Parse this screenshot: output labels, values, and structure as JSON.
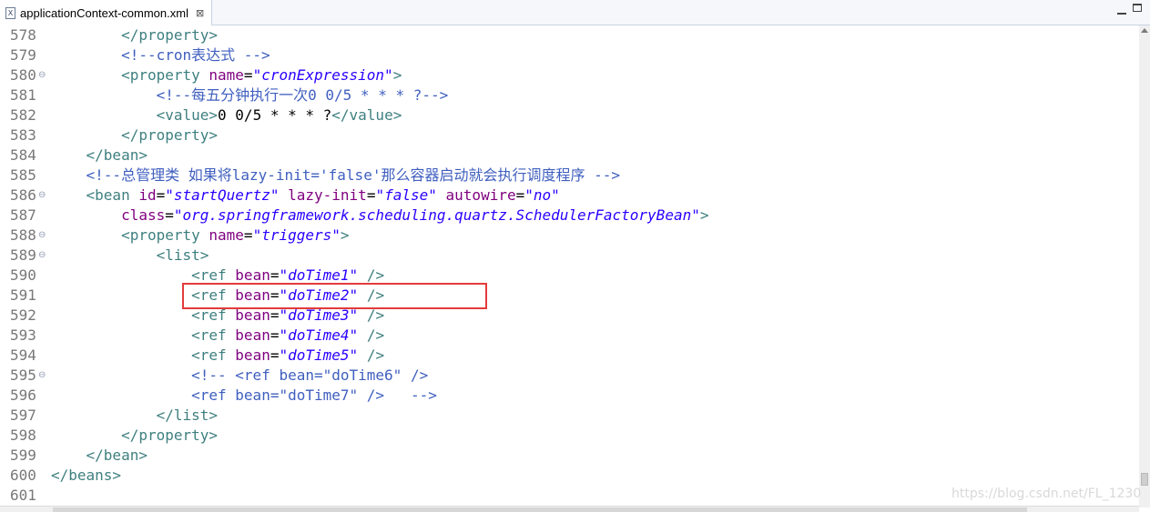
{
  "tab": {
    "icon": "xml-file-icon",
    "icon_glyph": "X",
    "title": "applicationContext-common.xml",
    "close_glyph": "⊠"
  },
  "lines": [
    {
      "num": "578",
      "fold": "",
      "segs": [
        {
          "c": "t-txt",
          "t": "        "
        },
        {
          "c": "t-tag",
          "t": "</property>"
        }
      ]
    },
    {
      "num": "579",
      "fold": "",
      "segs": [
        {
          "c": "t-txt",
          "t": "        "
        },
        {
          "c": "t-com",
          "t": "<!--cron表达式 -->"
        }
      ]
    },
    {
      "num": "580",
      "fold": "⊖",
      "segs": [
        {
          "c": "t-txt",
          "t": "        "
        },
        {
          "c": "t-tag",
          "t": "<property "
        },
        {
          "c": "t-attr",
          "t": "name"
        },
        {
          "c": "t-txt",
          "t": "="
        },
        {
          "c": "t-val",
          "t": "\"cronExpression\""
        },
        {
          "c": "t-tag",
          "t": ">"
        }
      ]
    },
    {
      "num": "581",
      "fold": "",
      "segs": [
        {
          "c": "t-txt",
          "t": "            "
        },
        {
          "c": "t-com",
          "t": "<!--每五分钟执行一次0 0/5 * * * ?-->"
        }
      ]
    },
    {
      "num": "582",
      "fold": "",
      "segs": [
        {
          "c": "t-txt",
          "t": "            "
        },
        {
          "c": "t-tag",
          "t": "<value>"
        },
        {
          "c": "t-txt",
          "t": "0 0/5 * * * ?"
        },
        {
          "c": "t-tag",
          "t": "</value>"
        }
      ]
    },
    {
      "num": "583",
      "fold": "",
      "segs": [
        {
          "c": "t-txt",
          "t": "        "
        },
        {
          "c": "t-tag",
          "t": "</property>"
        }
      ]
    },
    {
      "num": "584",
      "fold": "",
      "segs": [
        {
          "c": "t-txt",
          "t": "    "
        },
        {
          "c": "t-tag",
          "t": "</bean>"
        }
      ]
    },
    {
      "num": "585",
      "fold": "",
      "segs": [
        {
          "c": "t-txt",
          "t": "    "
        },
        {
          "c": "t-com",
          "t": "<!--总管理类 如果将lazy-init='false'那么容器启动就会执行调度程序 -->"
        }
      ]
    },
    {
      "num": "586",
      "fold": "⊖",
      "segs": [
        {
          "c": "t-txt",
          "t": "    "
        },
        {
          "c": "t-tag",
          "t": "<bean "
        },
        {
          "c": "t-attr",
          "t": "id"
        },
        {
          "c": "t-txt",
          "t": "="
        },
        {
          "c": "t-val",
          "t": "\"startQuertz\""
        },
        {
          "c": "t-txt",
          "t": " "
        },
        {
          "c": "t-attr",
          "t": "lazy-init"
        },
        {
          "c": "t-txt",
          "t": "="
        },
        {
          "c": "t-val",
          "t": "\"false\""
        },
        {
          "c": "t-txt",
          "t": " "
        },
        {
          "c": "t-attr",
          "t": "autowire"
        },
        {
          "c": "t-txt",
          "t": "="
        },
        {
          "c": "t-val",
          "t": "\"no\""
        }
      ]
    },
    {
      "num": "587",
      "fold": "",
      "segs": [
        {
          "c": "t-txt",
          "t": "        "
        },
        {
          "c": "t-attr",
          "t": "class"
        },
        {
          "c": "t-txt",
          "t": "="
        },
        {
          "c": "t-val",
          "t": "\"org.springframework.scheduling.quartz.SchedulerFactoryBean\""
        },
        {
          "c": "t-tag",
          "t": ">"
        }
      ]
    },
    {
      "num": "588",
      "fold": "⊖",
      "segs": [
        {
          "c": "t-txt",
          "t": "        "
        },
        {
          "c": "t-tag",
          "t": "<property "
        },
        {
          "c": "t-attr",
          "t": "name"
        },
        {
          "c": "t-txt",
          "t": "="
        },
        {
          "c": "t-val",
          "t": "\"triggers\""
        },
        {
          "c": "t-tag",
          "t": ">"
        }
      ]
    },
    {
      "num": "589",
      "fold": "⊖",
      "segs": [
        {
          "c": "t-txt",
          "t": "            "
        },
        {
          "c": "t-tag",
          "t": "<list>"
        }
      ]
    },
    {
      "num": "590",
      "fold": "",
      "segs": [
        {
          "c": "t-txt",
          "t": "                "
        },
        {
          "c": "t-tag",
          "t": "<ref "
        },
        {
          "c": "t-attr",
          "t": "bean"
        },
        {
          "c": "t-txt",
          "t": "="
        },
        {
          "c": "t-val",
          "t": "\"doTime1\""
        },
        {
          "c": "t-txt",
          "t": " "
        },
        {
          "c": "t-tag",
          "t": "/>"
        }
      ]
    },
    {
      "num": "591",
      "fold": "",
      "segs": [
        {
          "c": "t-txt",
          "t": "                "
        },
        {
          "c": "t-tag",
          "t": "<ref "
        },
        {
          "c": "t-attr",
          "t": "bean"
        },
        {
          "c": "t-txt",
          "t": "="
        },
        {
          "c": "t-val",
          "t": "\"doTime2\""
        },
        {
          "c": "t-txt",
          "t": " "
        },
        {
          "c": "t-tag",
          "t": "/>"
        }
      ]
    },
    {
      "num": "592",
      "fold": "",
      "segs": [
        {
          "c": "t-txt",
          "t": "                "
        },
        {
          "c": "t-tag",
          "t": "<ref "
        },
        {
          "c": "t-attr",
          "t": "bean"
        },
        {
          "c": "t-txt",
          "t": "="
        },
        {
          "c": "t-val",
          "t": "\"doTime3\""
        },
        {
          "c": "t-txt",
          "t": " "
        },
        {
          "c": "t-tag",
          "t": "/>"
        }
      ]
    },
    {
      "num": "593",
      "fold": "",
      "segs": [
        {
          "c": "t-txt",
          "t": "                "
        },
        {
          "c": "t-tag",
          "t": "<ref "
        },
        {
          "c": "t-attr",
          "t": "bean"
        },
        {
          "c": "t-txt",
          "t": "="
        },
        {
          "c": "t-val",
          "t": "\"doTime4\""
        },
        {
          "c": "t-txt",
          "t": " "
        },
        {
          "c": "t-tag",
          "t": "/>"
        }
      ]
    },
    {
      "num": "594",
      "fold": "",
      "segs": [
        {
          "c": "t-txt",
          "t": "                "
        },
        {
          "c": "t-tag",
          "t": "<ref "
        },
        {
          "c": "t-attr",
          "t": "bean"
        },
        {
          "c": "t-txt",
          "t": "="
        },
        {
          "c": "t-val",
          "t": "\"doTime5\""
        },
        {
          "c": "t-txt",
          "t": " "
        },
        {
          "c": "t-tag",
          "t": "/>"
        }
      ]
    },
    {
      "num": "595",
      "fold": "⊖",
      "segs": [
        {
          "c": "t-txt",
          "t": "                "
        },
        {
          "c": "t-com",
          "t": "<!-- <ref bean=\"doTime6\" />"
        }
      ]
    },
    {
      "num": "596",
      "fold": "",
      "segs": [
        {
          "c": "t-txt",
          "t": "                "
        },
        {
          "c": "t-com",
          "t": "<ref bean=\"doTime7\" />   -->"
        }
      ]
    },
    {
      "num": "597",
      "fold": "",
      "segs": [
        {
          "c": "t-txt",
          "t": "            "
        },
        {
          "c": "t-tag",
          "t": "</list>"
        }
      ]
    },
    {
      "num": "598",
      "fold": "",
      "segs": [
        {
          "c": "t-txt",
          "t": "        "
        },
        {
          "c": "t-tag",
          "t": "</property>"
        }
      ]
    },
    {
      "num": "599",
      "fold": "",
      "segs": [
        {
          "c": "t-txt",
          "t": "    "
        },
        {
          "c": "t-tag",
          "t": "</bean>"
        }
      ]
    },
    {
      "num": "600",
      "fold": "",
      "segs": [
        {
          "c": "t-tag",
          "t": "</beans>"
        }
      ]
    },
    {
      "num": "601",
      "fold": "",
      "segs": []
    }
  ],
  "highlighted_line": "591",
  "highlight_color": "#e33b3b",
  "watermark": "https://blog.csdn.net/FL_1230"
}
